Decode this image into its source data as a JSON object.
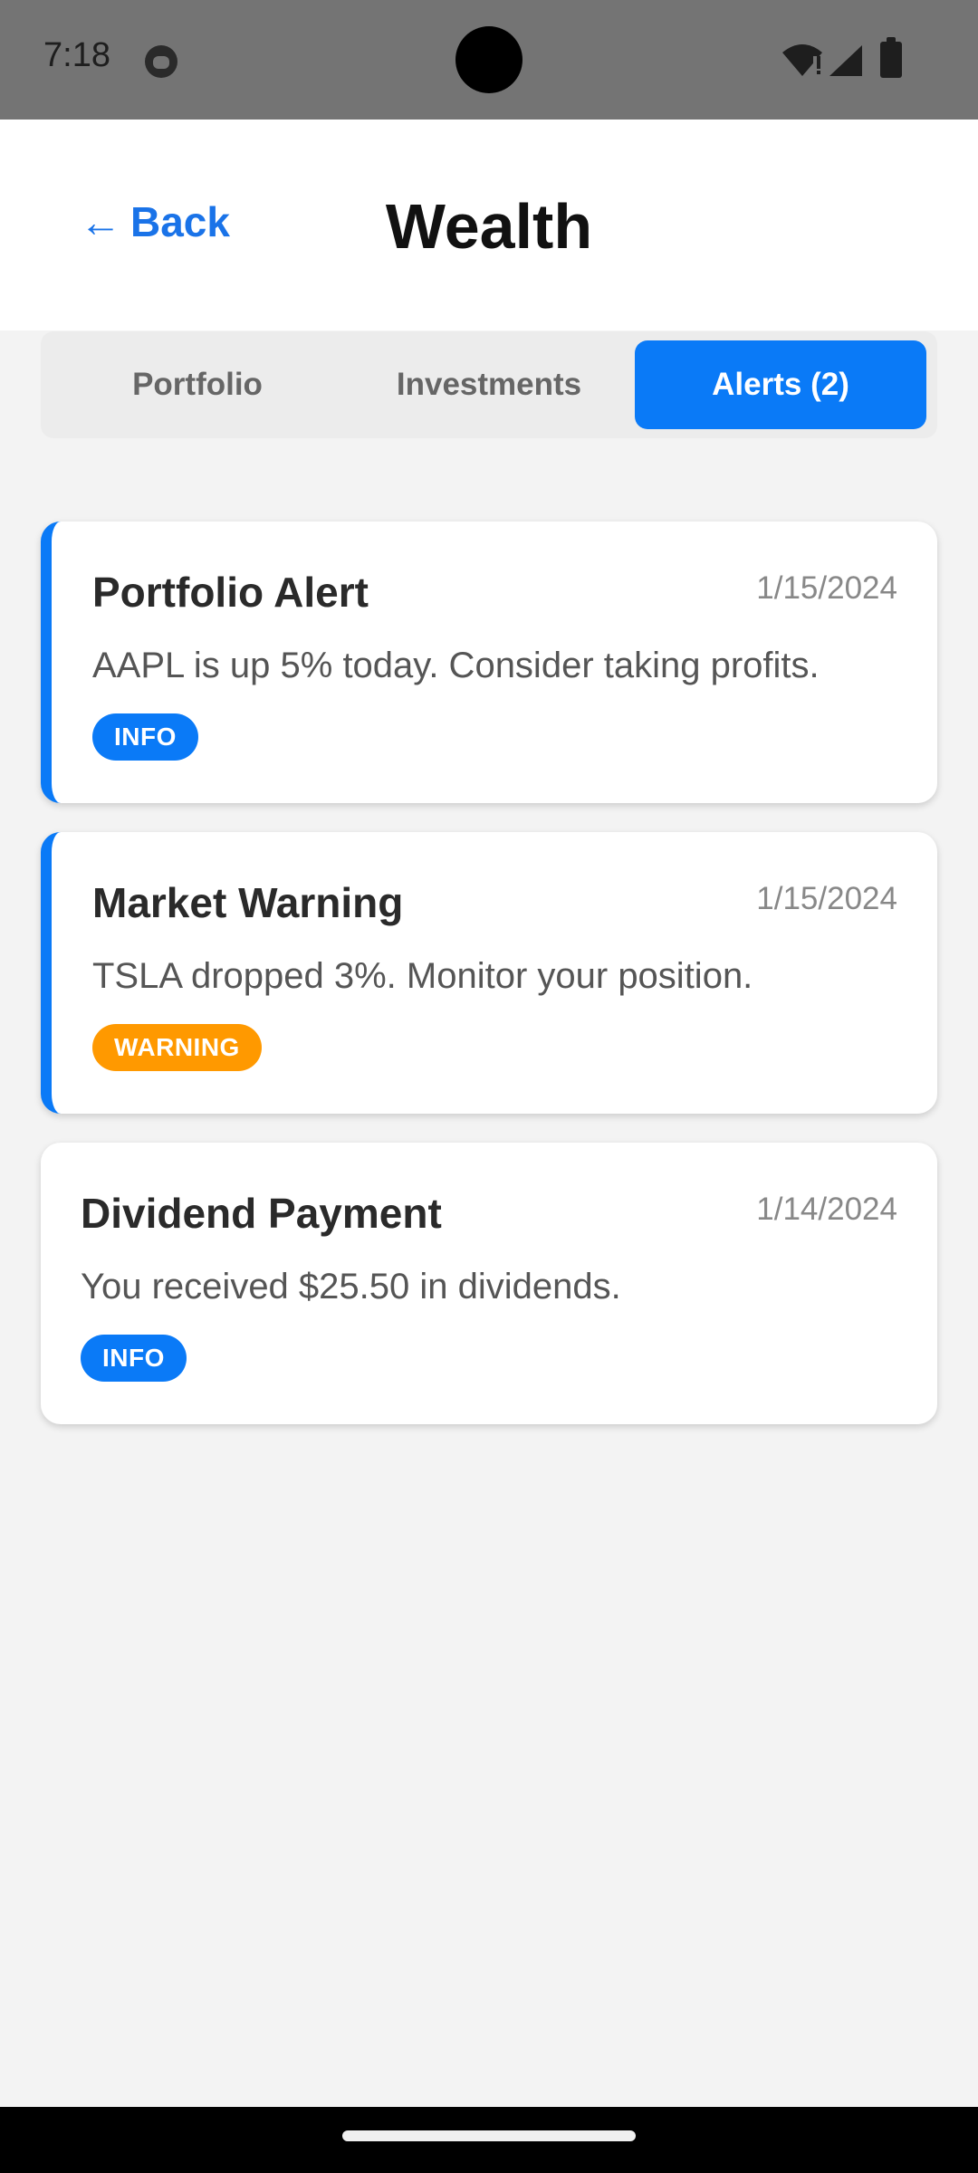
{
  "status_bar": {
    "time": "7:18",
    "icons": [
      "app-notification-icon",
      "wifi-icon",
      "signal-icon",
      "battery-icon"
    ]
  },
  "header": {
    "back_label": "Back",
    "back_icon": "arrow-left-icon",
    "title": "Wealth"
  },
  "tabs": [
    {
      "label": "Portfolio",
      "active": false
    },
    {
      "label": "Investments",
      "active": false
    },
    {
      "label": "Alerts (2)",
      "active": true
    }
  ],
  "alerts": [
    {
      "title": "Portfolio Alert",
      "date": "1/15/2024",
      "message": "AAPL is up 5% today. Consider taking profits.",
      "badge": "INFO",
      "unread": true
    },
    {
      "title": "Market Warning",
      "date": "1/15/2024",
      "message": "TSLA dropped 3%. Monitor your position.",
      "badge": "WARNING",
      "unread": true
    },
    {
      "title": "Dividend Payment",
      "date": "1/14/2024",
      "message": "You received $25.50 in dividends.",
      "badge": "INFO",
      "unread": false
    }
  ],
  "colors": {
    "accent": "#0a7af7",
    "info_badge": "#0a7af7",
    "warning_badge": "#ff9900",
    "background": "#f3f3f3"
  }
}
